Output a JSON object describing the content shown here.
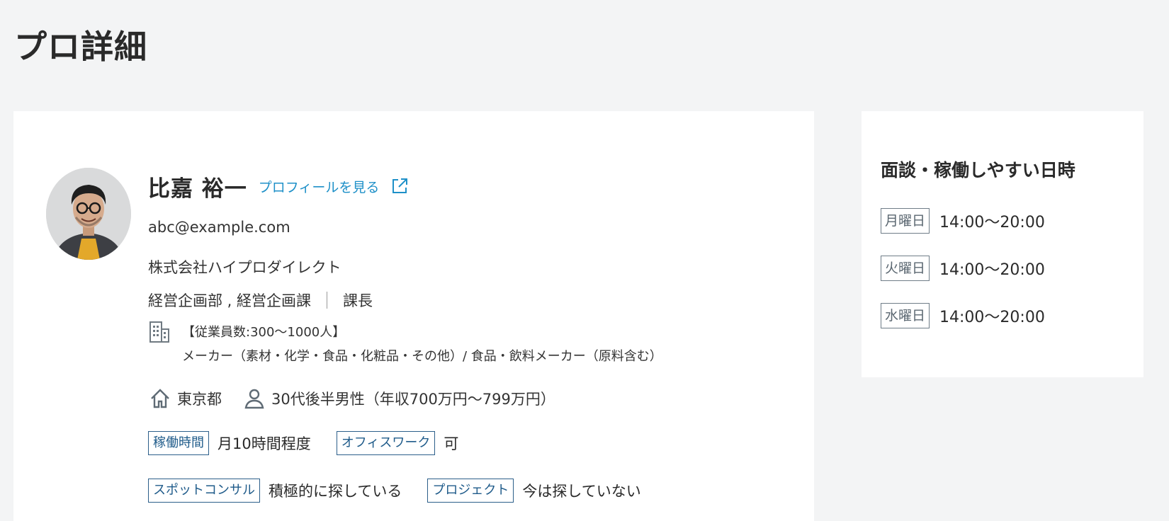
{
  "page": {
    "title": "プロ詳細"
  },
  "pro": {
    "name": "比嘉 裕一",
    "profile_link": "プロフィールを見る",
    "email": "abc@example.com",
    "company": "株式会社ハイプロダイレクト",
    "department": "経営企画部 , 経営企画課",
    "position": "課長",
    "employees": "【従業員数:300〜1000人】",
    "industry": "メーカー（素材・化学・食品・化粧品・その他）/ 食品・飲料メーカー（原料含む）",
    "location": "東京都",
    "demographic": "30代後半男性（年収700万円〜799万円）"
  },
  "tags": [
    {
      "label": "稼働時間",
      "value": "月10時間程度"
    },
    {
      "label": "オフィスワーク",
      "value": "可"
    },
    {
      "label": "スポットコンサル",
      "value": "積極的に探している"
    },
    {
      "label": "プロジェクト",
      "value": "今は探していない"
    }
  ],
  "schedule": {
    "title": "面談・稼働しやすい日時",
    "items": [
      {
        "day": "月曜日",
        "time": "14:00〜20:00"
      },
      {
        "day": "火曜日",
        "time": "14:00〜20:00"
      },
      {
        "day": "水曜日",
        "time": "14:00〜20:00"
      }
    ]
  },
  "icons": {
    "external_link": "external-link-icon",
    "building": "building-icon",
    "home": "home-icon",
    "person": "person-icon"
  },
  "colors": {
    "link": "#1e90c8",
    "tag_border": "#2c5f8a",
    "day_tag_border": "#6f7d88",
    "background": "#f3f4f5"
  }
}
